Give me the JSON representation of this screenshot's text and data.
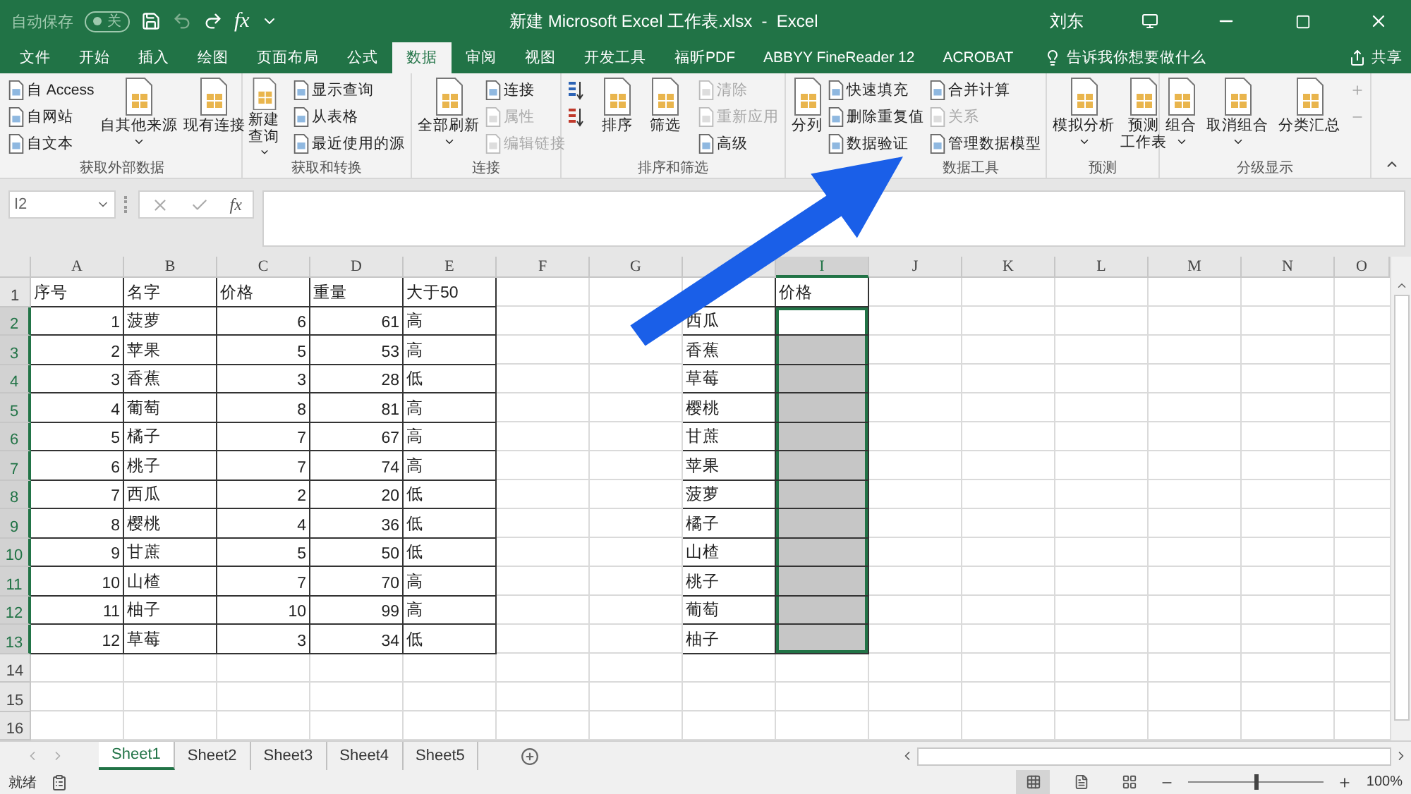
{
  "title_bar": {
    "autosave_label": "自动保存",
    "autosave_on": false,
    "autosave_state": "关",
    "function_glyph": "fx",
    "title": "新建 Microsoft Excel 工作表.xlsx  -  Excel",
    "user": "刘东"
  },
  "ribbon_tabs": [
    {
      "label": "文件",
      "selected": false
    },
    {
      "label": "开始",
      "selected": false
    },
    {
      "label": "插入",
      "selected": false
    },
    {
      "label": "绘图",
      "selected": false
    },
    {
      "label": "页面布局",
      "selected": false
    },
    {
      "label": "公式",
      "selected": false
    },
    {
      "label": "数据",
      "selected": true
    },
    {
      "label": "审阅",
      "selected": false
    },
    {
      "label": "视图",
      "selected": false
    },
    {
      "label": "开发工具",
      "selected": false
    },
    {
      "label": "福昕PDF",
      "selected": false
    },
    {
      "label": "ABBYY FineReader 12",
      "selected": false
    },
    {
      "label": "ACROBAT",
      "selected": false
    }
  ],
  "tell_me": "告诉我你想要做什么",
  "share": "共享",
  "ribbon_groups": [
    {
      "label": "获取外部数据",
      "items": [
        {
          "kind": "stack",
          "items": [
            {
              "label": "自 Access",
              "disabled": false
            },
            {
              "label": "自网站",
              "disabled": false
            },
            {
              "label": "自文本",
              "disabled": false
            }
          ]
        },
        {
          "kind": "large",
          "lines": [
            "自其他来源"
          ],
          "dropdown": true
        },
        {
          "kind": "large",
          "lines": [
            "现有连接"
          ],
          "dropdown": false
        }
      ]
    },
    {
      "label": "获取和转换",
      "items": [
        {
          "kind": "large",
          "lines": [
            "新建",
            "查询"
          ],
          "dropdown": true
        },
        {
          "kind": "stack",
          "items": [
            {
              "label": "显示查询",
              "disabled": false
            },
            {
              "label": "从表格",
              "disabled": false
            },
            {
              "label": "最近使用的源",
              "disabled": false
            }
          ]
        }
      ]
    },
    {
      "label": "连接",
      "items": [
        {
          "kind": "large",
          "lines": [
            "全部刷新"
          ],
          "dropdown": true
        },
        {
          "kind": "stack",
          "items": [
            {
              "label": "连接",
              "disabled": false
            },
            {
              "label": "属性",
              "disabled": true
            },
            {
              "label": "编辑链接",
              "disabled": true
            }
          ]
        }
      ]
    },
    {
      "label": "排序和筛选",
      "items": [
        {
          "kind": "sort"
        },
        {
          "kind": "large",
          "lines": [
            "排序"
          ],
          "dropdown": false
        },
        {
          "kind": "large",
          "lines": [
            "筛选"
          ],
          "dropdown": false
        },
        {
          "kind": "stack",
          "items": [
            {
              "label": "清除",
              "disabled": true
            },
            {
              "label": "重新应用",
              "disabled": true
            },
            {
              "label": "高级",
              "disabled": false
            }
          ]
        }
      ]
    },
    {
      "label": "数据工具",
      "items": [
        {
          "kind": "large",
          "lines": [
            "分列"
          ],
          "dropdown": false
        },
        {
          "kind": "stack",
          "items": [
            {
              "label": "快速填充",
              "disabled": false
            },
            {
              "label": "删除重复值",
              "disabled": false
            },
            {
              "label": "数据验证",
              "disabled": false
            }
          ]
        },
        {
          "kind": "stack",
          "items": [
            {
              "label": "合并计算",
              "disabled": false
            },
            {
              "label": "关系",
              "disabled": true
            },
            {
              "label": "管理数据模型",
              "disabled": false
            }
          ]
        }
      ]
    },
    {
      "label": "预测",
      "items": [
        {
          "kind": "large",
          "lines": [
            "模拟分析"
          ],
          "dropdown": true
        },
        {
          "kind": "large",
          "lines": [
            "预测",
            "工作表"
          ],
          "dropdown": false
        }
      ]
    },
    {
      "label": "分级显示",
      "items": [
        {
          "kind": "large",
          "lines": [
            "组合"
          ],
          "dropdown": true
        },
        {
          "kind": "large",
          "lines": [
            "取消组合"
          ],
          "dropdown": true
        },
        {
          "kind": "large",
          "lines": [
            "分类汇总"
          ],
          "dropdown": false
        },
        {
          "kind": "detail"
        }
      ]
    }
  ],
  "formula_bar": {
    "name_box": "I2",
    "function_glyph": "fx"
  },
  "columns": [
    {
      "label": "A",
      "selected": false
    },
    {
      "label": "B",
      "selected": false
    },
    {
      "label": "C",
      "selected": false
    },
    {
      "label": "D",
      "selected": false
    },
    {
      "label": "E",
      "selected": false
    },
    {
      "label": "F",
      "selected": false
    },
    {
      "label": "G",
      "selected": false
    },
    {
      "selected": false
    },
    {
      "label": "I",
      "selected": true
    },
    {
      "label": "J",
      "selected": false
    },
    {
      "label": "K",
      "selected": false
    },
    {
      "label": "L",
      "selected": false
    },
    {
      "label": "M",
      "selected": false
    },
    {
      "label": "N",
      "selected": false
    },
    {
      "label": "O",
      "selected": false
    }
  ],
  "row_headers": [
    {
      "label": "1",
      "selected": false
    },
    {
      "label": "2",
      "selected": true
    },
    {
      "label": "3",
      "selected": true
    },
    {
      "label": "4",
      "selected": true
    },
    {
      "label": "5",
      "selected": true
    },
    {
      "label": "6",
      "selected": true
    },
    {
      "label": "7",
      "selected": true
    },
    {
      "label": "8",
      "selected": true
    },
    {
      "label": "9",
      "selected": true
    },
    {
      "label": "10",
      "selected": true
    },
    {
      "label": "11",
      "selected": true
    },
    {
      "label": "12",
      "selected": true
    },
    {
      "label": "13",
      "selected": true
    },
    {
      "label": "14",
      "selected": false
    },
    {
      "label": "15",
      "selected": false
    },
    {
      "label": "16",
      "selected": false
    }
  ],
  "table_1": {
    "header": [
      "序号",
      "名字",
      "价格",
      "重量",
      "大于50"
    ],
    "rows": [
      [
        "1",
        "菠萝",
        "6",
        "61",
        "高"
      ],
      [
        "2",
        "苹果",
        "5",
        "53",
        "高"
      ],
      [
        "3",
        "香蕉",
        "3",
        "28",
        "低"
      ],
      [
        "4",
        "葡萄",
        "8",
        "81",
        "高"
      ],
      [
        "5",
        "橘子",
        "7",
        "67",
        "高"
      ],
      [
        "6",
        "桃子",
        "7",
        "74",
        "高"
      ],
      [
        "7",
        "西瓜",
        "2",
        "20",
        "低"
      ],
      [
        "8",
        "樱桃",
        "4",
        "36",
        "低"
      ],
      [
        "9",
        "甘蔗",
        "5",
        "50",
        "低"
      ],
      [
        "10",
        "山楂",
        "7",
        "70",
        "高"
      ],
      [
        "11",
        "柚子",
        "10",
        "99",
        "高"
      ],
      [
        "12",
        "草莓",
        "3",
        "34",
        "低"
      ]
    ]
  },
  "table_2": {
    "price_header": "价格",
    "rows": [
      {
        "name": "西瓜",
        "selected": true,
        "active": true
      },
      {
        "name": "香蕉",
        "selected": true,
        "active": false
      },
      {
        "name": "草莓",
        "selected": true,
        "active": false
      },
      {
        "name": "樱桃",
        "selected": true,
        "active": false
      },
      {
        "name": "甘蔗",
        "selected": true,
        "active": false
      },
      {
        "name": "苹果",
        "selected": true,
        "active": false
      },
      {
        "name": "菠萝",
        "selected": true,
        "active": false
      },
      {
        "name": "橘子",
        "selected": true,
        "active": false
      },
      {
        "name": "山楂",
        "selected": true,
        "active": false
      },
      {
        "name": "桃子",
        "selected": true,
        "active": false
      },
      {
        "name": "葡萄",
        "selected": true,
        "active": false
      },
      {
        "name": "柚子",
        "selected": true,
        "active": false
      }
    ]
  },
  "sheet_tabs": [
    {
      "label": "Sheet1",
      "selected": true
    },
    {
      "label": "Sheet2",
      "selected": false
    },
    {
      "label": "Sheet3",
      "selected": false
    },
    {
      "label": "Sheet4",
      "selected": false
    },
    {
      "label": "Sheet5",
      "selected": false
    }
  ],
  "status_bar": {
    "status": "就绪",
    "view_buttons": [
      {
        "selected": true
      },
      {
        "selected": false
      },
      {
        "selected": false
      }
    ],
    "zoom": {
      "level": 0.5
    },
    "zoom_text": "100%"
  }
}
